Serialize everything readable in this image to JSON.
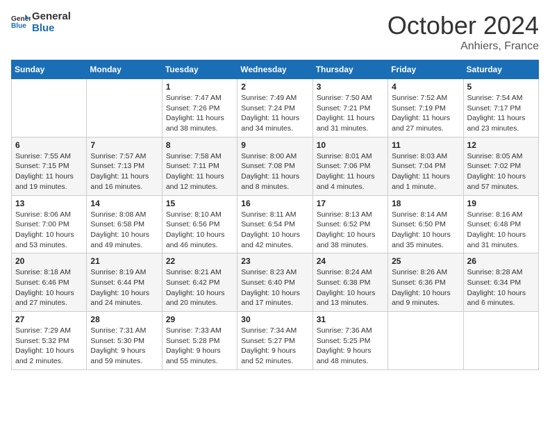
{
  "logo": {
    "line1": "General",
    "line2": "Blue"
  },
  "title": "October 2024",
  "location": "Anhiers, France",
  "days_header": [
    "Sunday",
    "Monday",
    "Tuesday",
    "Wednesday",
    "Thursday",
    "Friday",
    "Saturday"
  ],
  "weeks": [
    [
      {
        "day": "",
        "sunrise": "",
        "sunset": "",
        "daylight": ""
      },
      {
        "day": "",
        "sunrise": "",
        "sunset": "",
        "daylight": ""
      },
      {
        "day": "1",
        "sunrise": "Sunrise: 7:47 AM",
        "sunset": "Sunset: 7:26 PM",
        "daylight": "Daylight: 11 hours and 38 minutes."
      },
      {
        "day": "2",
        "sunrise": "Sunrise: 7:49 AM",
        "sunset": "Sunset: 7:24 PM",
        "daylight": "Daylight: 11 hours and 34 minutes."
      },
      {
        "day": "3",
        "sunrise": "Sunrise: 7:50 AM",
        "sunset": "Sunset: 7:21 PM",
        "daylight": "Daylight: 11 hours and 31 minutes."
      },
      {
        "day": "4",
        "sunrise": "Sunrise: 7:52 AM",
        "sunset": "Sunset: 7:19 PM",
        "daylight": "Daylight: 11 hours and 27 minutes."
      },
      {
        "day": "5",
        "sunrise": "Sunrise: 7:54 AM",
        "sunset": "Sunset: 7:17 PM",
        "daylight": "Daylight: 11 hours and 23 minutes."
      }
    ],
    [
      {
        "day": "6",
        "sunrise": "Sunrise: 7:55 AM",
        "sunset": "Sunset: 7:15 PM",
        "daylight": "Daylight: 11 hours and 19 minutes."
      },
      {
        "day": "7",
        "sunrise": "Sunrise: 7:57 AM",
        "sunset": "Sunset: 7:13 PM",
        "daylight": "Daylight: 11 hours and 16 minutes."
      },
      {
        "day": "8",
        "sunrise": "Sunrise: 7:58 AM",
        "sunset": "Sunset: 7:11 PM",
        "daylight": "Daylight: 11 hours and 12 minutes."
      },
      {
        "day": "9",
        "sunrise": "Sunrise: 8:00 AM",
        "sunset": "Sunset: 7:08 PM",
        "daylight": "Daylight: 11 hours and 8 minutes."
      },
      {
        "day": "10",
        "sunrise": "Sunrise: 8:01 AM",
        "sunset": "Sunset: 7:06 PM",
        "daylight": "Daylight: 11 hours and 4 minutes."
      },
      {
        "day": "11",
        "sunrise": "Sunrise: 8:03 AM",
        "sunset": "Sunset: 7:04 PM",
        "daylight": "Daylight: 11 hours and 1 minute."
      },
      {
        "day": "12",
        "sunrise": "Sunrise: 8:05 AM",
        "sunset": "Sunset: 7:02 PM",
        "daylight": "Daylight: 10 hours and 57 minutes."
      }
    ],
    [
      {
        "day": "13",
        "sunrise": "Sunrise: 8:06 AM",
        "sunset": "Sunset: 7:00 PM",
        "daylight": "Daylight: 10 hours and 53 minutes."
      },
      {
        "day": "14",
        "sunrise": "Sunrise: 8:08 AM",
        "sunset": "Sunset: 6:58 PM",
        "daylight": "Daylight: 10 hours and 49 minutes."
      },
      {
        "day": "15",
        "sunrise": "Sunrise: 8:10 AM",
        "sunset": "Sunset: 6:56 PM",
        "daylight": "Daylight: 10 hours and 46 minutes."
      },
      {
        "day": "16",
        "sunrise": "Sunrise: 8:11 AM",
        "sunset": "Sunset: 6:54 PM",
        "daylight": "Daylight: 10 hours and 42 minutes."
      },
      {
        "day": "17",
        "sunrise": "Sunrise: 8:13 AM",
        "sunset": "Sunset: 6:52 PM",
        "daylight": "Daylight: 10 hours and 38 minutes."
      },
      {
        "day": "18",
        "sunrise": "Sunrise: 8:14 AM",
        "sunset": "Sunset: 6:50 PM",
        "daylight": "Daylight: 10 hours and 35 minutes."
      },
      {
        "day": "19",
        "sunrise": "Sunrise: 8:16 AM",
        "sunset": "Sunset: 6:48 PM",
        "daylight": "Daylight: 10 hours and 31 minutes."
      }
    ],
    [
      {
        "day": "20",
        "sunrise": "Sunrise: 8:18 AM",
        "sunset": "Sunset: 6:46 PM",
        "daylight": "Daylight: 10 hours and 27 minutes."
      },
      {
        "day": "21",
        "sunrise": "Sunrise: 8:19 AM",
        "sunset": "Sunset: 6:44 PM",
        "daylight": "Daylight: 10 hours and 24 minutes."
      },
      {
        "day": "22",
        "sunrise": "Sunrise: 8:21 AM",
        "sunset": "Sunset: 6:42 PM",
        "daylight": "Daylight: 10 hours and 20 minutes."
      },
      {
        "day": "23",
        "sunrise": "Sunrise: 8:23 AM",
        "sunset": "Sunset: 6:40 PM",
        "daylight": "Daylight: 10 hours and 17 minutes."
      },
      {
        "day": "24",
        "sunrise": "Sunrise: 8:24 AM",
        "sunset": "Sunset: 6:38 PM",
        "daylight": "Daylight: 10 hours and 13 minutes."
      },
      {
        "day": "25",
        "sunrise": "Sunrise: 8:26 AM",
        "sunset": "Sunset: 6:36 PM",
        "daylight": "Daylight: 10 hours and 9 minutes."
      },
      {
        "day": "26",
        "sunrise": "Sunrise: 8:28 AM",
        "sunset": "Sunset: 6:34 PM",
        "daylight": "Daylight: 10 hours and 6 minutes."
      }
    ],
    [
      {
        "day": "27",
        "sunrise": "Sunrise: 7:29 AM",
        "sunset": "Sunset: 5:32 PM",
        "daylight": "Daylight: 10 hours and 2 minutes."
      },
      {
        "day": "28",
        "sunrise": "Sunrise: 7:31 AM",
        "sunset": "Sunset: 5:30 PM",
        "daylight": "Daylight: 9 hours and 59 minutes."
      },
      {
        "day": "29",
        "sunrise": "Sunrise: 7:33 AM",
        "sunset": "Sunset: 5:28 PM",
        "daylight": "Daylight: 9 hours and 55 minutes."
      },
      {
        "day": "30",
        "sunrise": "Sunrise: 7:34 AM",
        "sunset": "Sunset: 5:27 PM",
        "daylight": "Daylight: 9 hours and 52 minutes."
      },
      {
        "day": "31",
        "sunrise": "Sunrise: 7:36 AM",
        "sunset": "Sunset: 5:25 PM",
        "daylight": "Daylight: 9 hours and 48 minutes."
      },
      {
        "day": "",
        "sunrise": "",
        "sunset": "",
        "daylight": ""
      },
      {
        "day": "",
        "sunrise": "",
        "sunset": "",
        "daylight": ""
      }
    ]
  ]
}
